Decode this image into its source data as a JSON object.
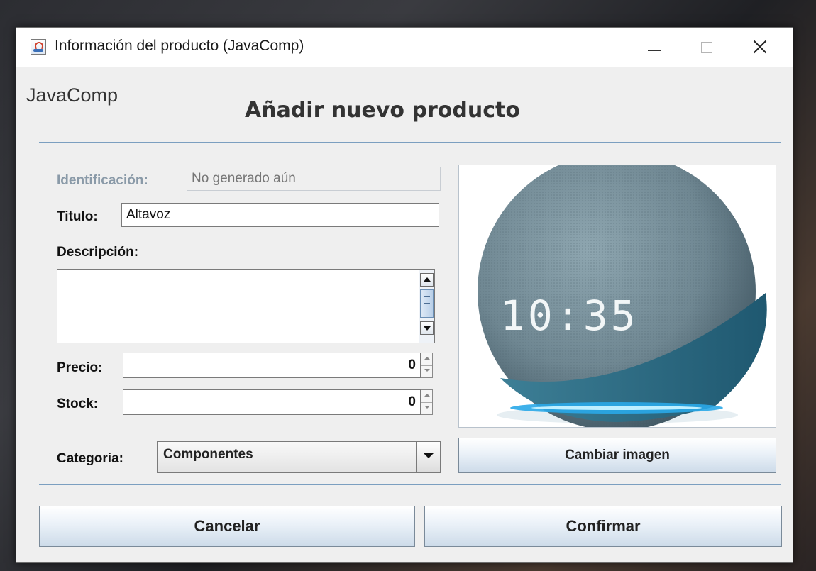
{
  "window": {
    "title": "Información del producto (JavaComp)"
  },
  "header": {
    "brand": "JavaComp",
    "title": "Añadir nuevo producto"
  },
  "form": {
    "id_label": "Identificación:",
    "id_placeholder": "No generado aún",
    "title_label": "Titulo:",
    "title_value": "Altavoz",
    "desc_label": "Descripción:",
    "desc_value": "",
    "price_label": "Precio:",
    "price_value": "0",
    "stock_label": "Stock:",
    "stock_value": "0",
    "category_label": "Categoria:",
    "category_value": "Componentes"
  },
  "image": {
    "clock_display": "10:35",
    "change_button": "Cambiar imagen"
  },
  "actions": {
    "cancel": "Cancelar",
    "confirm": "Confirmar"
  },
  "colors": {
    "speaker_body": "#6f8792",
    "speaker_base": "#2d6f86",
    "light_ring": "#2aa8e8"
  }
}
